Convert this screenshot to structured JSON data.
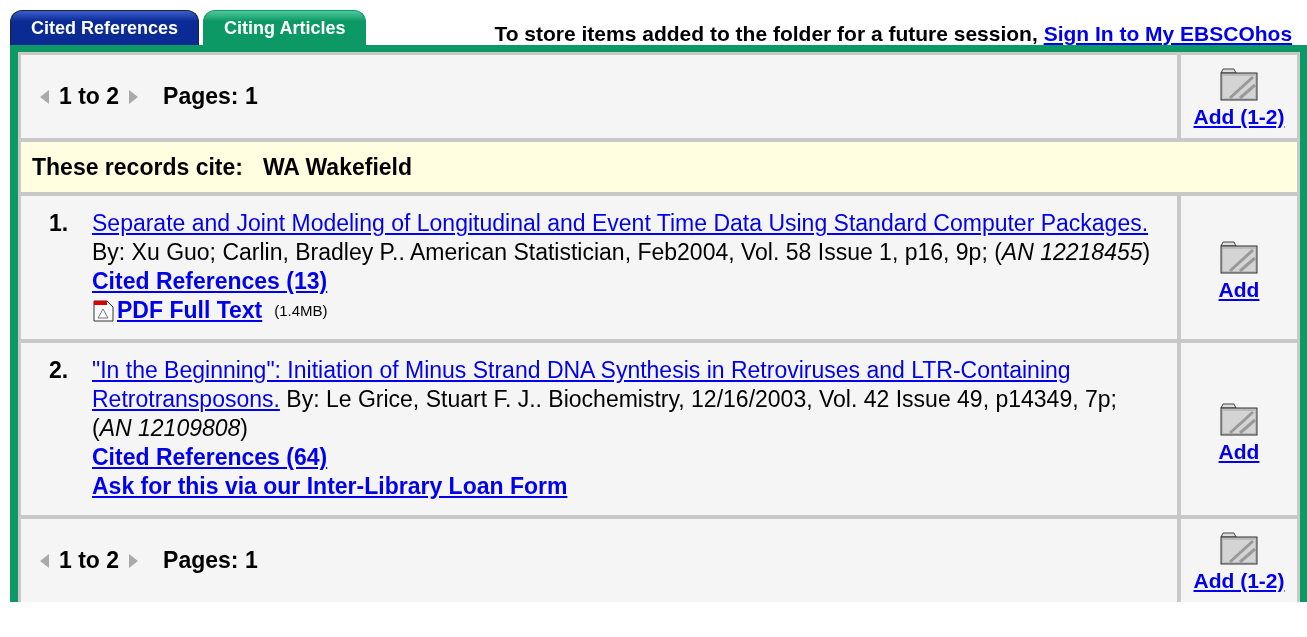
{
  "tabs": [
    {
      "label": "Cited References",
      "selected": false
    },
    {
      "label": "Citing Articles",
      "selected": true
    }
  ],
  "notice": {
    "text": "To store items added to the folder for a future session,",
    "link": "Sign In to My EBSCOhos"
  },
  "pager_top": {
    "range": "1 to 2",
    "pages": "Pages: 1",
    "add": "Add (1-2)"
  },
  "cite_line": {
    "label": "These records cite:",
    "author": "WA Wakefield"
  },
  "records": [
    {
      "number": "1.",
      "title_lines": [
        "Separate and Joint Modeling of Longitudinal and Event Time Data Using Standard Computer Packages."
      ],
      "details": "By: Xu Guo; Carlin, Bradley P.. American Statistician, Feb2004, Vol. 58 Issue 1, p16, 9p; (*AN 12218455*)",
      "links": [
        {
          "kind": "cited",
          "text": "Cited References (13)"
        },
        {
          "kind": "pdf",
          "text": "PDF Full Text",
          "size": "(1.4MB)"
        }
      ],
      "add": "Add"
    },
    {
      "number": "2.",
      "title_lines": [
        "\"In the Beginning\": Initiation of Minus Strand DNA Synthesis in Retroviruses and LTR-Containing",
        "Retrotransposons."
      ],
      "details": "By: Le Grice, Stuart F. J.. Biochemistry, 12/16/2003, Vol. 42 Issue 49, p14349, 7p; (*AN 12109808*)",
      "links": [
        {
          "kind": "cited",
          "text": "Cited References (64)"
        },
        {
          "kind": "loan",
          "text": "Ask for this via our Inter-Library Loan Form"
        }
      ],
      "add": "Add"
    }
  ],
  "pager_bottom": {
    "range": "1 to 2",
    "pages": "Pages: 1",
    "add": "Add (1-2)"
  }
}
